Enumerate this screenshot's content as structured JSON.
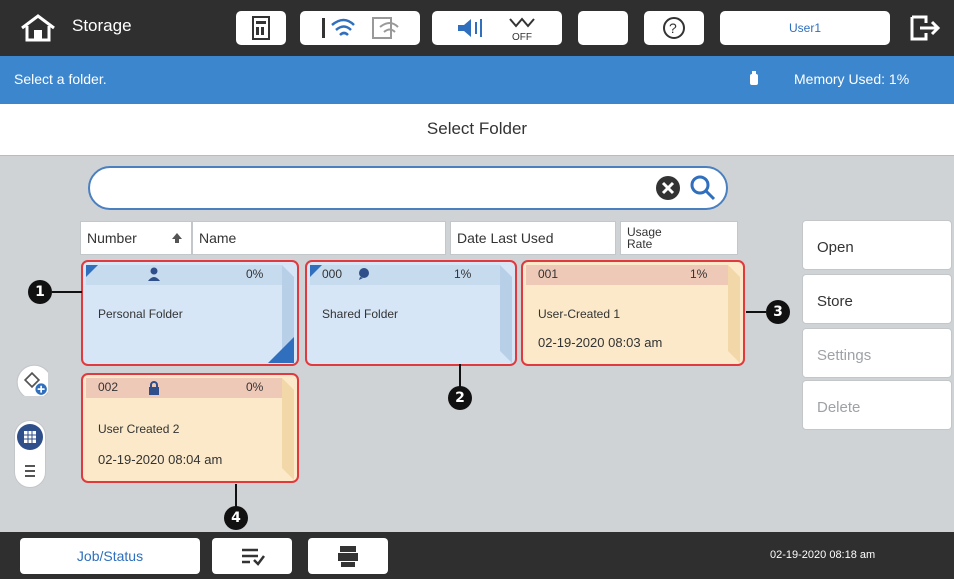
{
  "header": {
    "app_title": "Storage",
    "user": "User1",
    "status_icons": [
      "sd-card-icon",
      "wifi-icon",
      "wifi-direct-icon",
      "sound-icon",
      "ethernet-off-icon",
      "sleep-icon",
      "help-icon"
    ],
    "ethernet_label": "OFF"
  },
  "status": {
    "message": "Select a folder.",
    "memory": "Memory Used: 1%"
  },
  "page": {
    "title": "Select Folder"
  },
  "search": {
    "value": "",
    "placeholder": ""
  },
  "columns": {
    "number": "Number",
    "name": "Name",
    "date": "Date Last Used",
    "usage": "Usage Rate"
  },
  "actions": {
    "open": "Open",
    "store": "Store",
    "settings": "Settings",
    "delete": "Delete"
  },
  "folders": [
    {
      "number": "",
      "usage": "0%",
      "name": "Personal Folder",
      "date": "",
      "icon": "person-icon",
      "color": "#d6e6f7",
      "callout": "1"
    },
    {
      "number": "000",
      "usage": "1%",
      "name": "Shared Folder",
      "date": "",
      "icon": "chat-bubble-icon",
      "color": "#d6e6f7",
      "callout": "2"
    },
    {
      "number": "001",
      "usage": "1%",
      "name": "User-Created 1",
      "date": "02-19-2020 08:03 am",
      "icon": "",
      "color": "#fbe9c9",
      "callout": "3"
    },
    {
      "number": "002",
      "usage": "0%",
      "name": "User Created 2",
      "date": "02-19-2020 08:04 am",
      "icon": "lock-icon",
      "color": "#fbe9c9",
      "callout": "4"
    }
  ],
  "colors": {
    "accent": "#3b86cc",
    "highlight": "#e0393e",
    "shared_top": "#c7dbef",
    "user_top": "#efc9b8"
  },
  "footer": {
    "job_status": "Job/Status",
    "datetime": "02-19-2020 08:18 am"
  }
}
